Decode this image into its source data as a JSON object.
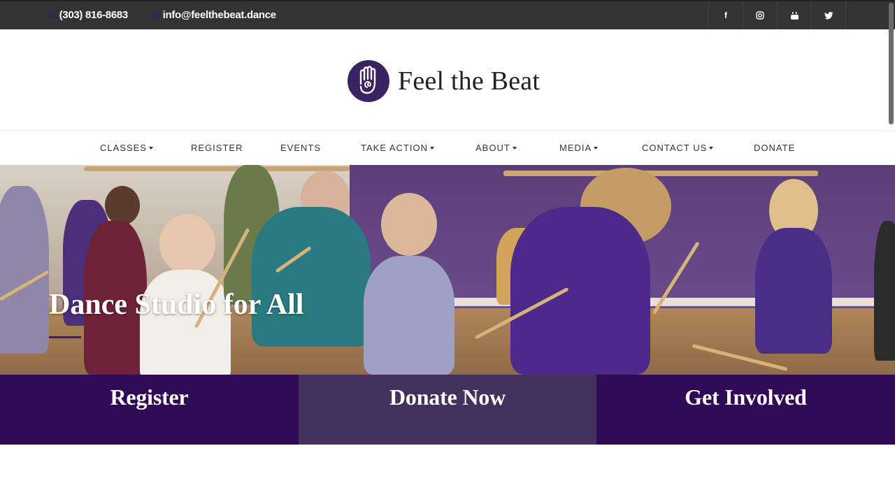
{
  "topbar": {
    "phone": "(303) 816-8683",
    "email": "info@feelthebeat.dance",
    "social": [
      {
        "icon": "facebook-icon",
        "glyph": "f"
      },
      {
        "icon": "instagram-icon",
        "glyph": "◎"
      },
      {
        "icon": "youtube-icon",
        "glyph": "▶"
      },
      {
        "icon": "twitter-icon",
        "glyph": "🐦"
      }
    ]
  },
  "logo": {
    "text": "Feel the Beat",
    "icon": "hand-spiral-icon"
  },
  "nav": {
    "items": [
      {
        "label": "CLASSES",
        "dropdown": true
      },
      {
        "label": "REGISTER",
        "dropdown": false
      },
      {
        "label": "EVENTS",
        "dropdown": false
      },
      {
        "label": "TAKE ACTION",
        "dropdown": true
      },
      {
        "label": "ABOUT",
        "dropdown": true
      },
      {
        "label": "MEDIA",
        "dropdown": true
      },
      {
        "label": "CONTACT US",
        "dropdown": true
      },
      {
        "label": "DONATE",
        "dropdown": false
      }
    ]
  },
  "hero": {
    "title": "Dance Studio for All"
  },
  "cta": {
    "register": "Register",
    "donate": "Donate Now",
    "involved": "Get Involved"
  },
  "colors": {
    "brand_purple": "#310a56",
    "mid_purple": "#43305c",
    "topbar": "#333333"
  }
}
